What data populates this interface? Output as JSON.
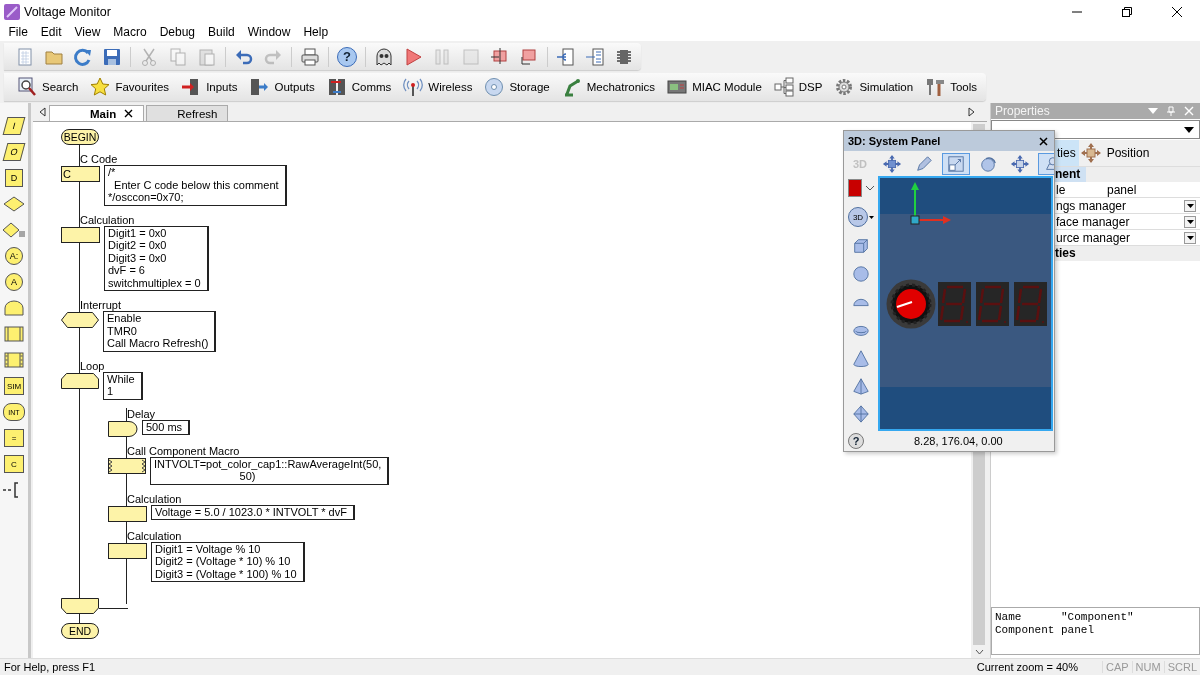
{
  "window": {
    "title": "Voltage Monitor"
  },
  "menu": [
    "File",
    "Edit",
    "View",
    "Macro",
    "Debug",
    "Build",
    "Window",
    "Help"
  ],
  "toolbar_groups": [
    [
      {
        "kind": "new",
        "disabled": false
      },
      {
        "kind": "open",
        "disabled": false
      },
      {
        "kind": "reload",
        "disabled": false
      },
      {
        "kind": "save",
        "disabled": false
      }
    ],
    [
      {
        "kind": "cut",
        "disabled": true
      },
      {
        "kind": "copy",
        "disabled": true
      },
      {
        "kind": "paste",
        "disabled": true
      }
    ],
    [
      {
        "kind": "undo",
        "disabled": false
      },
      {
        "kind": "redo",
        "disabled": true
      }
    ],
    [
      {
        "kind": "print",
        "disabled": false
      }
    ],
    [
      {
        "kind": "help",
        "label": "?",
        "disabled": false
      }
    ],
    [
      {
        "kind": "ghost",
        "disabled": false
      },
      {
        "kind": "run",
        "disabled": false
      },
      {
        "kind": "pause",
        "disabled": true
      },
      {
        "kind": "stop",
        "disabled": true
      },
      {
        "kind": "step-into",
        "disabled": false
      },
      {
        "kind": "step-over",
        "disabled": false
      }
    ],
    [
      {
        "kind": "code-block",
        "disabled": false
      },
      {
        "kind": "data-block",
        "disabled": false
      },
      {
        "kind": "chip",
        "disabled": false
      }
    ]
  ],
  "component_toolbar": [
    {
      "kind": "search",
      "label": "Search"
    },
    {
      "kind": "star",
      "label": "Favourites"
    },
    {
      "kind": "inputs",
      "label": "Inputs"
    },
    {
      "kind": "outputs",
      "label": "Outputs"
    },
    {
      "kind": "comms",
      "label": "Comms"
    },
    {
      "kind": "wireless",
      "label": "Wireless"
    },
    {
      "kind": "disc",
      "label": "Storage"
    },
    {
      "kind": "arm",
      "label": "Mechatronics"
    },
    {
      "kind": "module",
      "label": "MIAC Module"
    },
    {
      "kind": "dsp",
      "label": "DSP"
    },
    {
      "kind": "gear",
      "label": "Simulation"
    },
    {
      "kind": "tools",
      "label": "Tools"
    }
  ],
  "palette": [
    {
      "kind": "input",
      "label": "I"
    },
    {
      "kind": "output",
      "label": "O"
    },
    {
      "kind": "delay",
      "label": "D"
    },
    {
      "kind": "decision"
    },
    {
      "kind": "switch"
    },
    {
      "kind": "call-circle",
      "label": "A:"
    },
    {
      "kind": "circle",
      "label": "A"
    },
    {
      "kind": "loop"
    },
    {
      "kind": "macro"
    },
    {
      "kind": "component-macro"
    },
    {
      "kind": "box",
      "label": "SIM"
    },
    {
      "kind": "interrupt",
      "label": "INT"
    },
    {
      "kind": "box",
      "label": "="
    },
    {
      "kind": "box",
      "label": "C"
    },
    {
      "kind": "comment"
    }
  ],
  "editor": {
    "tabs": [
      {
        "label": "Main",
        "selected": true,
        "closable": true
      },
      {
        "label": "Refresh",
        "selected": false,
        "closable": false
      }
    ]
  },
  "flowchart": {
    "steps": [
      {
        "kind": "begin",
        "label": "BEGIN"
      },
      {
        "kind": "code",
        "title": "C Code",
        "label": "C",
        "lines": [
          "/*",
          "  Enter C code below this comment",
          "*/osccon=0x70;"
        ]
      },
      {
        "kind": "calculation",
        "title": "Calculation",
        "lines": [
          "Digit1 = 0x0",
          "Digit2 = 0x0",
          "Digit3 = 0x0",
          "dvF = 6",
          "switchmultiplex = 0"
        ]
      },
      {
        "kind": "interrupt",
        "title": "Interrupt",
        "lines": [
          "Enable",
          "TMR0",
          "Call Macro Refresh()"
        ]
      },
      {
        "kind": "loop",
        "title": "Loop",
        "lines": [
          "While",
          "1"
        ],
        "children": [
          {
            "kind": "delay",
            "title": "Delay",
            "lines": [
              "500 ms"
            ]
          },
          {
            "kind": "component-macro",
            "title": "Call Component Macro",
            "lines": [
              "INTVOLT=pot_color_cap1::RawAverageInt(50,",
              "                            50)"
            ]
          },
          {
            "kind": "calculation",
            "title": "Calculation",
            "lines": [
              "Voltage = 5.0 / 1023.0 * INTVOLT * dvF"
            ]
          },
          {
            "kind": "calculation",
            "title": "Calculation",
            "lines": [
              "Digit1 = Voltage % 10",
              "Digit2 = (Voltage * 10) % 10",
              "Digit3 = (Voltage * 100) % 10"
            ]
          }
        ]
      },
      {
        "kind": "end",
        "label": "END"
      }
    ]
  },
  "system_panel": {
    "title": "3D: System Panel",
    "toolbar": [
      {
        "kind": "mode",
        "label": "3D",
        "disabled": true
      },
      {
        "kind": "move",
        "selected": false
      },
      {
        "kind": "pencil",
        "selected": false
      },
      {
        "kind": "box-select",
        "selected": true
      },
      {
        "kind": "rotate",
        "selected": false
      },
      {
        "kind": "pan",
        "selected": false
      },
      {
        "kind": "camera",
        "selected": true
      }
    ],
    "view_button": "3D",
    "tools": [
      {
        "kind": "cube"
      },
      {
        "kind": "sphere"
      },
      {
        "kind": "half-sphere"
      },
      {
        "kind": "disc"
      },
      {
        "kind": "cone"
      },
      {
        "kind": "pyramid"
      },
      {
        "kind": "octahedron"
      }
    ],
    "help": "?",
    "coordinates": "8.28, 176.04, 0.00"
  },
  "properties": {
    "title": "Properties",
    "tabs": [
      {
        "label": "ties",
        "selected": true
      },
      {
        "label": "Position",
        "selected": false
      }
    ],
    "groups": [
      {
        "title": "nent",
        "selected": true,
        "rows": [
          {
            "name": "le",
            "value": "panel",
            "dropdown": false
          },
          {
            "name": "ngs manager",
            "dropdown": true
          },
          {
            "name": "face manager",
            "dropdown": true
          },
          {
            "name": "urce manager",
            "dropdown": true
          }
        ]
      },
      {
        "title": "ties",
        "selected": false
      }
    ],
    "description": [
      "Name      \"Component\"",
      "Component panel"
    ]
  },
  "status_bar": {
    "help": "For Help, press F1",
    "zoom": "Current zoom = 40%",
    "indicators": [
      {
        "label": "CAP",
        "on": false
      },
      {
        "label": "NUM",
        "on": false
      },
      {
        "label": "SCRL",
        "on": false
      }
    ]
  }
}
